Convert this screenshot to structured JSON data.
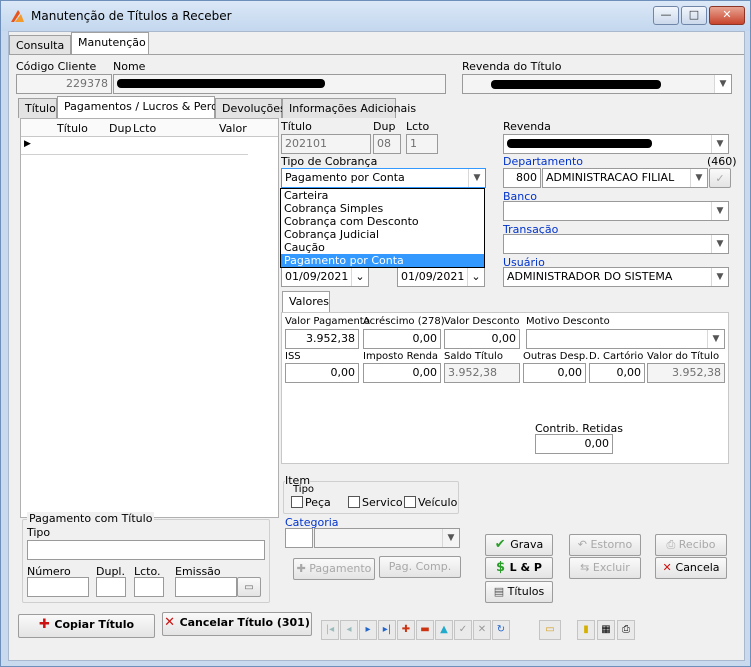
{
  "window": {
    "title": "Manutenção de Títulos a Receber",
    "min": "—",
    "max": "□",
    "close": "✕"
  },
  "top_tabs": [
    "Consulta",
    "Manutenção"
  ],
  "header": {
    "codigo_label": "Código Cliente",
    "codigo_value": "229378",
    "nome_label": "Nome",
    "revenda_titulo_label": "Revenda do Título"
  },
  "inner_tabs": [
    "Título",
    "Pagamentos / Lucros & Perdas",
    "Devoluções",
    "Informações Adicionais"
  ],
  "grid": {
    "columns": [
      "Título",
      "Dup",
      "Lcto",
      "Valor"
    ],
    "row_marker": "▶"
  },
  "titulo": {
    "label": "Título",
    "value": "202101",
    "dup_label": "Dup",
    "dup_value": "08",
    "lcto_label": "Lcto",
    "lcto_value": "1"
  },
  "tipo_cobranca": {
    "label": "Tipo de Cobrança",
    "selected": "Pagamento por Conta",
    "options": [
      "Carteira",
      "Cobrança Simples",
      "Cobrança com Desconto",
      "Cobrança Judicial",
      "Caução",
      "Pagamento por Conta"
    ]
  },
  "dates": {
    "date1": "01/09/2021",
    "date2": "01/09/2021"
  },
  "revenda": {
    "label": "Revenda"
  },
  "departamento": {
    "label": "Departamento",
    "count": "(460)",
    "code": "800",
    "name": "ADMINISTRACAO FILIAL"
  },
  "banco": {
    "label": "Banco"
  },
  "transacao": {
    "label": "Transação"
  },
  "usuario": {
    "label": "Usuário",
    "value": "ADMINISTRADOR DO SISTEMA"
  },
  "valores": {
    "tab": "Valores",
    "valor_pagamento_label": "Valor Pagamento",
    "valor_pagamento": "3.952,38",
    "acrescimo_label": "Acréscimo (278)",
    "acrescimo": "0,00",
    "valor_desconto_label": "Valor Desconto",
    "valor_desconto": "0,00",
    "motivo_desconto_label": "Motivo Desconto",
    "iss_label": "ISS",
    "iss": "0,00",
    "imposto_renda_label": "Imposto Renda",
    "imposto_renda": "0,00",
    "saldo_titulo_label": "Saldo Título",
    "saldo_titulo": "3.952,38",
    "outras_desp_label": "Outras Desp.",
    "outras_desp": "0,00",
    "d_cartorio_label": "D. Cartório",
    "d_cartorio": "0,00",
    "valor_titulo_label": "Valor do Título",
    "valor_titulo": "3.952,38",
    "contrib_label": "Contrib. Retidas",
    "contrib": "0,00"
  },
  "item": {
    "label": "Item",
    "tipo_label": "Tipo",
    "peca": "Peça",
    "servico": "Servico",
    "veiculo": "Veículo",
    "categoria_label": "Categoria"
  },
  "pagamento_titulo": {
    "label": "Pagamento com Título",
    "tipo_label": "Tipo",
    "numero_label": "Número",
    "dupl_label": "Dupl.",
    "lcto_label": "Lcto.",
    "emissao_label": "Emissão"
  },
  "buttons": {
    "pagamento": "Pagamento",
    "pag_comp": "Pag. Comp.",
    "grava": "Grava",
    "estorno": "Estorno",
    "recibo": "Recibo",
    "lp": "L & P",
    "excluir": "Excluir",
    "cancela": "Cancela",
    "titulos": "Títulos",
    "copiar_titulo": "Copiar Título",
    "cancelar_titulo": "Cancelar Título (301)"
  },
  "colors": {
    "accent": "#3399ff",
    "label_blue": "#0033cc",
    "ok_green": "#2a9d2a",
    "cancel_red": "#cc1111"
  }
}
